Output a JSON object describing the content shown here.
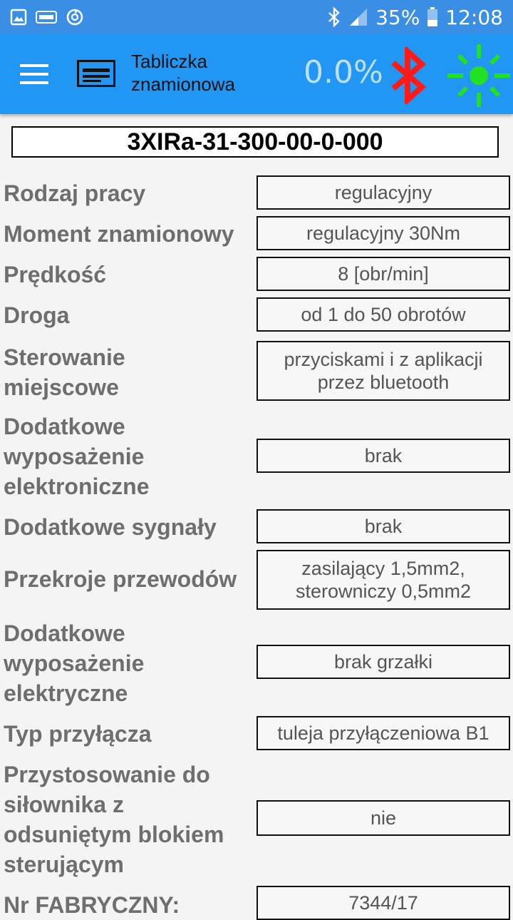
{
  "status_bar": {
    "battery": "35%",
    "time": "12:08"
  },
  "app_bar": {
    "title": "Tabliczka znamionowa",
    "progress": "0.0%",
    "bluetooth_color": "#ff1a1a",
    "led_color": "#22e022"
  },
  "serial_number": "3XIRa-31-300-00-0-000",
  "rows": [
    {
      "label": "Rodzaj pracy",
      "value": "regulacyjny"
    },
    {
      "label": "Moment znamionowy",
      "value": "regulacyjny 30Nm"
    },
    {
      "label": "Prędkość",
      "value": "8 [obr/min]"
    },
    {
      "label": "Droga",
      "value": "od 1 do 50 obrotów"
    },
    {
      "label": "Sterowanie miejscowe",
      "value": "przyciskami i z aplikacji przez bluetooth"
    },
    {
      "label": "Dodatkowe wyposażenie elektroniczne",
      "value": "brak"
    },
    {
      "label": "Dodatkowe sygnały",
      "value": "brak"
    },
    {
      "label": "Przekroje przewodów",
      "value": "zasilający 1,5mm2, sterowniczy 0,5mm2"
    },
    {
      "label": "Dodatkowe wyposażenie elektryczne",
      "value": "brak grzałki"
    },
    {
      "label": "Typ przyłącza",
      "value": "tuleja przyłączeniowa B1"
    },
    {
      "label": "Przystosowanie do siłownika z odsuniętym blokiem sterującym",
      "value": "nie"
    },
    {
      "label": "Nr FABRYCZNY:",
      "value": "7344/17"
    }
  ]
}
